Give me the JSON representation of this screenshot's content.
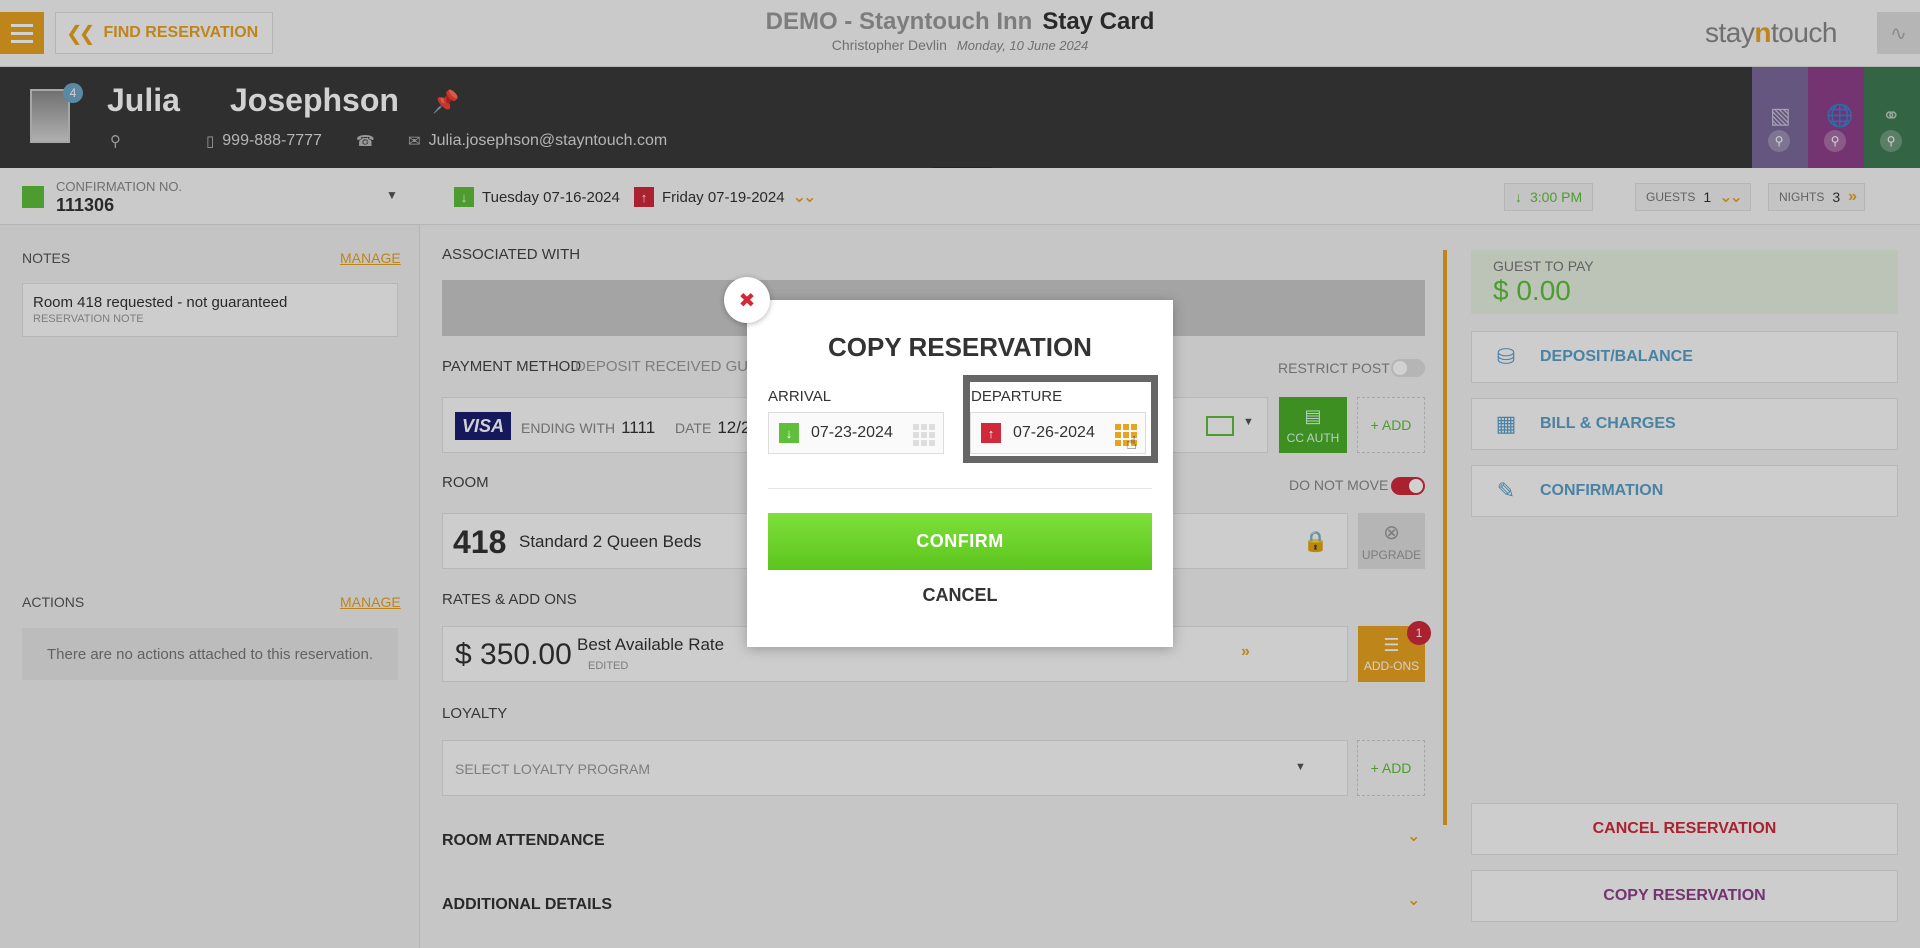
{
  "topbar": {
    "find_reservation": "FIND RESERVATION",
    "property": "DEMO - Stayntouch Inn",
    "page": "Stay Card",
    "user": "Christopher Devlin",
    "date": "Monday, 10 June 2024",
    "brand_a": "stay",
    "brand_b": "n",
    "brand_c": "touch"
  },
  "guest": {
    "first_name": "Julia",
    "last_name": "Josephson",
    "avatar_badge": "4",
    "phone": "999-888-7777",
    "email": "Julia.josephson@stayntouch.com",
    "tab_colors": [
      "#7a6a9a",
      "#8e3f8a",
      "#3f7a52"
    ]
  },
  "reservation": {
    "confirmation_label": "CONFIRMATION NO.",
    "confirmation_number": "111306",
    "arrival": "Tuesday 07-16-2024",
    "departure": "Friday 07-19-2024",
    "arrival_time": "3:00 PM",
    "guests_label": "GUESTS",
    "guests": "1",
    "nights_label": "NIGHTS",
    "nights": "3"
  },
  "notes": {
    "label": "NOTES",
    "manage": "MANAGE",
    "note_text": "Room 418 requested - not guaranteed",
    "note_type": "RESERVATION NOTE"
  },
  "actions": {
    "label": "ACTIONS",
    "manage": "MANAGE",
    "empty": "There are no actions attached to this reservation."
  },
  "main": {
    "associated_with": "ASSOCIATED WITH",
    "payment_method": "PAYMENT METHOD",
    "deposit_received": "DEPOSIT RECEIVED GUARA",
    "restrict_post": "RESTRICT POST",
    "card_brand": "VISA",
    "ending_with_label": "ENDING WITH",
    "ending_with": "1111",
    "date_label": "DATE",
    "date_value": "12/2",
    "cc_auth": "CC AUTH",
    "add": "+ ADD",
    "room_label": "ROOM",
    "do_not_move": "DO NOT MOVE",
    "room_number": "418",
    "room_type": "Standard 2 Queen Beds",
    "upgrade": "UPGRADE",
    "rates_label": "RATES & ADD ONS",
    "rate_amount": "$ 350.00",
    "rate_name": "Best Available Rate",
    "rate_status": "EDITED",
    "addons": "ADD-ONS",
    "addons_count": "1",
    "loyalty_label": "LOYALTY",
    "loyalty_placeholder": "SELECT LOYALTY PROGRAM",
    "room_attendance": "ROOM ATTENDANCE",
    "additional_details": "ADDITIONAL DETAILS"
  },
  "right": {
    "guest_to_pay_label": "GUEST TO PAY",
    "guest_to_pay": "$ 0.00",
    "deposit_balance": "DEPOSIT/BALANCE",
    "bill_charges": "BILL & CHARGES",
    "confirmation": "CONFIRMATION",
    "cancel_reservation": "CANCEL RESERVATION",
    "copy_reservation": "COPY RESERVATION"
  },
  "modal": {
    "title": "COPY RESERVATION",
    "arrival_label": "ARRIVAL",
    "arrival_value": "07-23-2024",
    "departure_label": "DEPARTURE",
    "departure_value": "07-26-2024",
    "confirm": "CONFIRM",
    "cancel": "CANCEL"
  },
  "colors": {
    "accent": "#e8a321",
    "green": "#5fbf3a",
    "red": "#d0293a",
    "blue": "#5aa0c8",
    "purple": "#8e3f8a"
  }
}
